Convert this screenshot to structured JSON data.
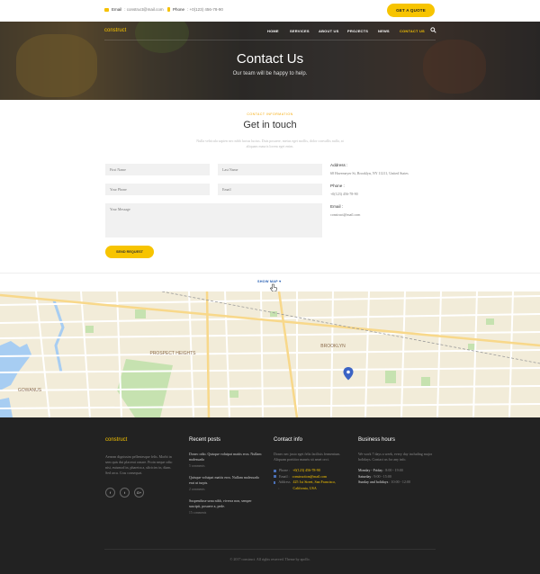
{
  "topbar": {
    "email_label": "Email",
    "email_value": ": construct@mail.com",
    "phone_label": "Phone",
    "phone_value": ": +0(123) 456-78-90",
    "quote_button": "GET A QUOTE"
  },
  "header": {
    "logo": "construct",
    "nav": [
      "HOME",
      "SERVICES",
      "ABOUT US",
      "PROJECTS",
      "NEWS",
      "CONTACT US"
    ],
    "active_nav": "CONTACT US",
    "title": "Contact Us",
    "subtitle": "Our team will be happy to help."
  },
  "contact": {
    "eyebrow": "CONTACT INFORMATION",
    "title": "Get in touch",
    "intro": "Nulla vehicula sapien nec nibh luctus luctus. Duis posuere, metus eget mollis, dolor convallis nulla, at aliquam mauris lorem eget enim.",
    "fields": {
      "first_name": "First Name",
      "last_name": "Last Name",
      "phone": "Your Phone",
      "email": "Email",
      "message": "Your Message"
    },
    "send_button": "SEND REQUEST",
    "info": {
      "address_label": "Address :",
      "address_value": "68 Havemeyer St, Brooklyn, NY 11211, United States",
      "phone_label": "Phone :",
      "phone_value": "+0(123) 456-78-90",
      "email_label": "Email :",
      "email_value": "construct@mail.com"
    },
    "show_map": "SHOW MAP"
  },
  "map_labels": {
    "prospect_heights": "PROSPECT HEIGHTS",
    "gowanus": "GOWANUS",
    "brooklyn": "BROOKLYN"
  },
  "footer": {
    "logo": "construct",
    "about": "Aenean dignissim pellentesque felis. Morbi in sem quis dui placerat ornare. Proin neque odio nisi, euismod in, pharetra a, ultricies in, diam. Sed arcu. Cras consequat.",
    "social": [
      "f",
      "t",
      "G+"
    ],
    "recent_posts_title": "Recent posts",
    "posts": [
      {
        "title": "Donec odio. Quisque volutpat mattis eros. Nullam malesuada",
        "comments": "5 comments"
      },
      {
        "title": "Quisque volutpat mattis eros. Nullam malesuada erat ut turpis.",
        "comments": "2 comments"
      },
      {
        "title": "Suspendisse urna nibh, viverra non, semper suscipit, posuere a, pede.",
        "comments": "15 comments"
      }
    ],
    "contact_title": "Contact info",
    "contact_text": "Donec nec justo eget felis facilisis fermentum. Aliquam porttitor mauris sit amet orci.",
    "contact_phone_label": "Phone :",
    "contact_phone": "+0(123) 456-78-90",
    "contact_email_label": "Email :",
    "contact_email": "construction@mail.com",
    "contact_address_label": "Address :",
    "contact_address": "425 1st Street, San Francisco, California, USA",
    "hours_title": "Business hours",
    "hours_text": "We work 7 days a week, every day including major holidays. Contact us for any info.",
    "hours": [
      {
        "day": "Monday - Friday",
        "time": ": 8:00 - 19:00"
      },
      {
        "day": "Saturday",
        "time": ": 9:00 - 15:00"
      },
      {
        "day": "Sunday and holidays",
        "time": ": 10:00 - 12:00"
      }
    ],
    "copyright": "© 2017 construct. All rights reserved. Theme by apollo."
  },
  "colors": {
    "accent": "#f7c400",
    "footer_bg": "#222222",
    "link": "#2c63b5"
  }
}
